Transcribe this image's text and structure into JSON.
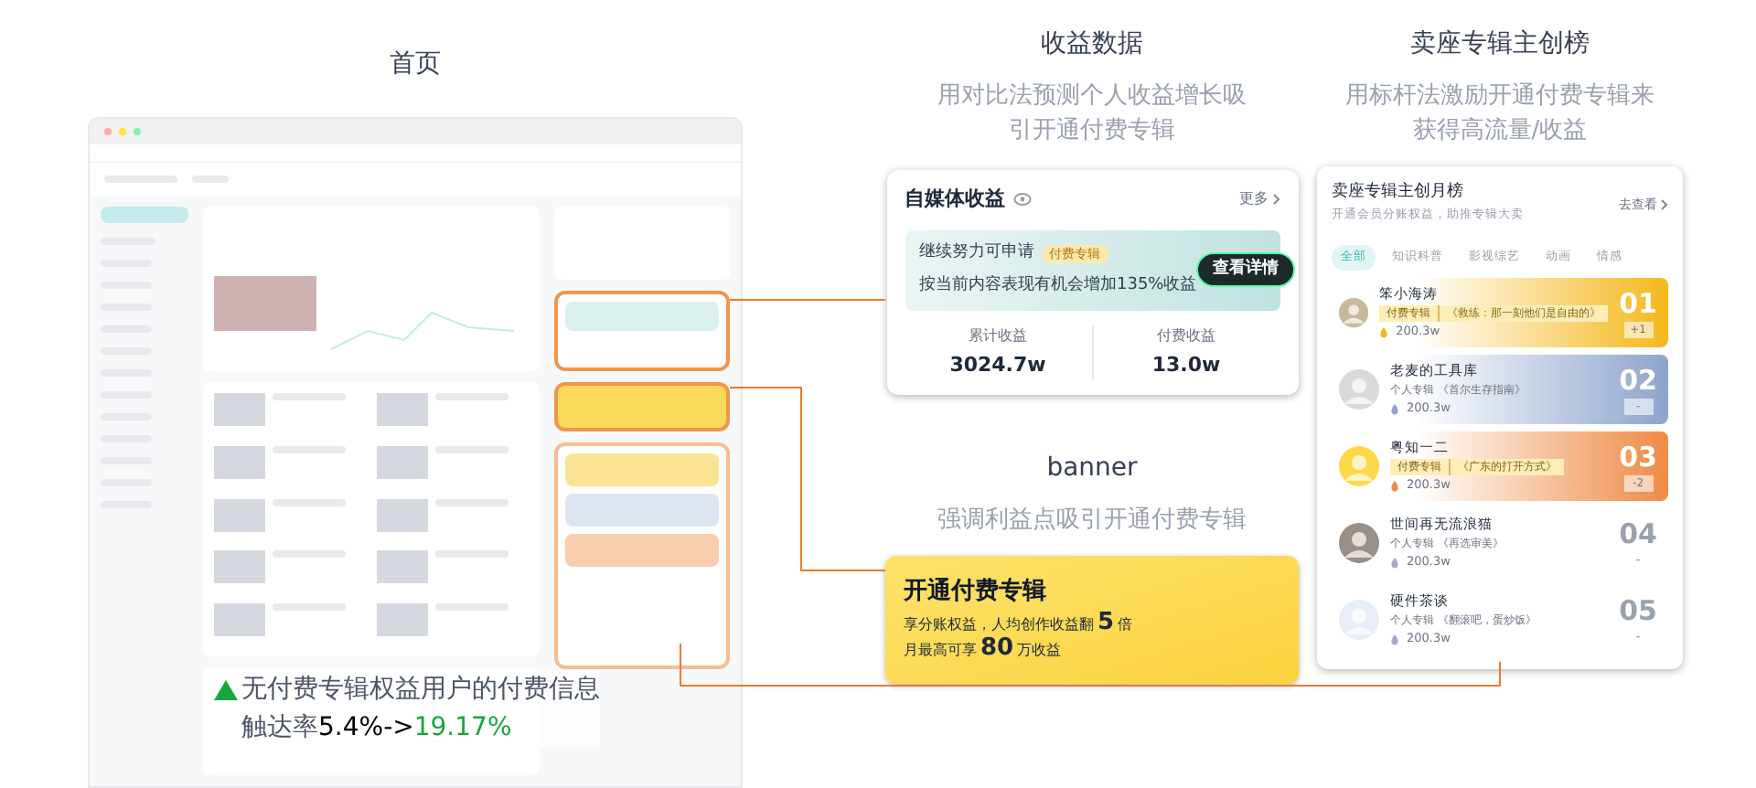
{
  "home": {
    "title": "首页",
    "note": {
      "line1": "无付费专辑权益用户的付费信息",
      "label": "触达率",
      "before": "5.4%->",
      "after": "19.17%"
    }
  },
  "income": {
    "title": "收益数据",
    "subtitle": [
      "用对比法预测个人收益增长吸",
      "引开通付费专辑"
    ],
    "card": {
      "title": "自媒体收益",
      "more": "更多",
      "prompt": "继续努力可申请",
      "tag": "付费专辑",
      "message": "按当前内容表现有机会增加135%收益",
      "button": "查看详情",
      "stats": [
        {
          "label": "累计收益",
          "value": "3024.7w"
        },
        {
          "label": "付费收益",
          "value": "13.0w"
        }
      ]
    }
  },
  "banner": {
    "title": "banner",
    "subtitle": "强调利益点吸引开通付费专辑",
    "card": {
      "title": "开通付费专辑",
      "lines": [
        "享分账权益，人均创作收益翻**5**倍",
        "月最高可享**80**万收益"
      ]
    }
  },
  "ranking": {
    "title": "卖座专辑主创榜",
    "subtitle": [
      "用标杆法激励开通付费专辑来",
      "获得高流量/收益"
    ],
    "card": {
      "title": "卖座专辑主创月榜",
      "caption": "开通会员分账权益，助推专辑大卖",
      "more": "去查看",
      "tabs": [
        {
          "label": "全部",
          "selected": true
        },
        {
          "label": "知识科普",
          "selected": false
        },
        {
          "label": "影视综艺",
          "selected": false
        },
        {
          "label": "动画",
          "selected": false
        },
        {
          "label": "情感",
          "selected": false
        }
      ],
      "rows": [
        {
          "name": "笨小海涛",
          "kind": "paid",
          "tag": "付费专辑",
          "album": "《救练：那一刻他们是自由的》",
          "count": "200.3w",
          "rank": "01",
          "change": "+1",
          "color": "#f5b81c"
        },
        {
          "name": "老麦的工具库",
          "kind": "personal",
          "tag": "个人专辑",
          "album": "《首尔生存指南》",
          "count": "200.3w",
          "rank": "02",
          "change": "-",
          "color": "#8ea4cc"
        },
        {
          "name": "粤知一二",
          "kind": "paid",
          "tag": "付费专辑",
          "album": "《广东的打开方式》",
          "count": "200.3w",
          "rank": "03",
          "change": "-2",
          "color": "#ee8a45"
        },
        {
          "name": "世间再无流浪猫",
          "kind": "personal",
          "tag": "个人专辑",
          "album": "《再选审美》",
          "count": "200.3w",
          "rank": "04",
          "change": "-"
        },
        {
          "name": "硬件茶谈",
          "kind": "personal",
          "tag": "个人专辑",
          "album": "《翻滚吧，蛋炒饭》",
          "count": "200.3w",
          "rank": "05",
          "change": "-"
        }
      ]
    }
  }
}
